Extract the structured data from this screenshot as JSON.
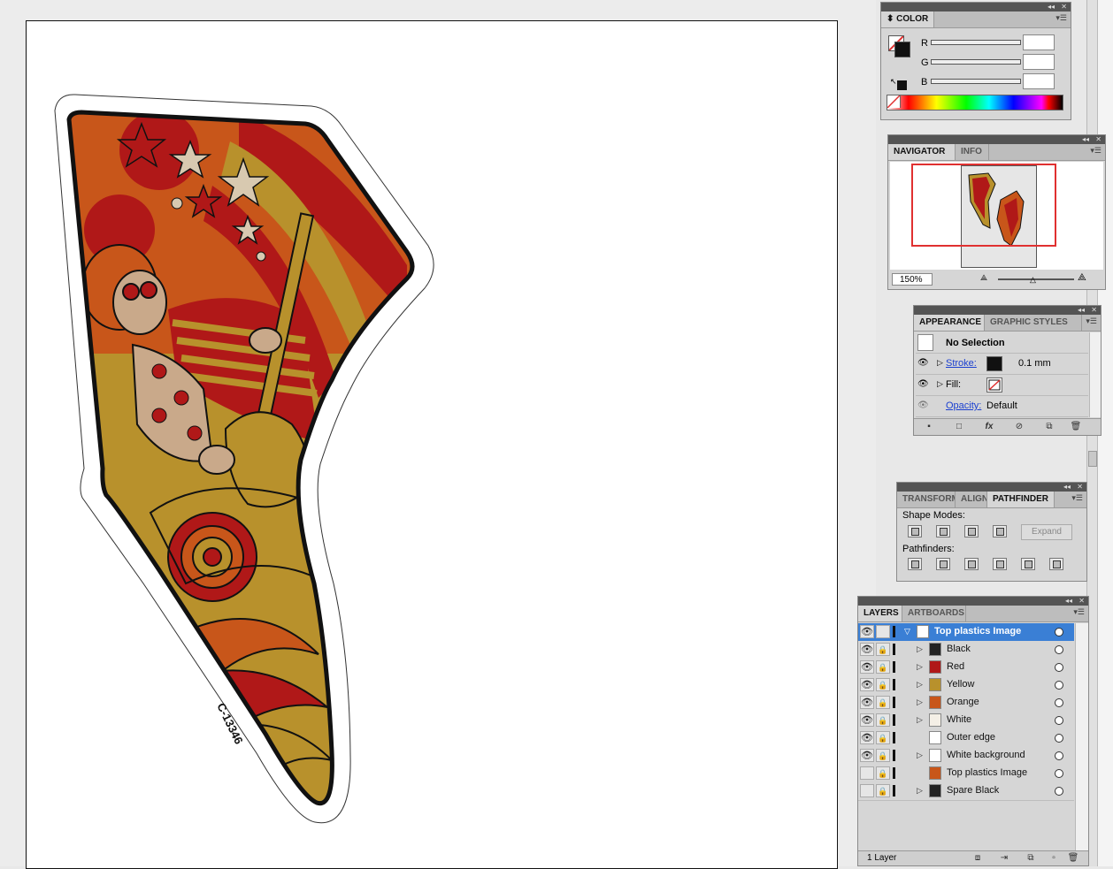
{
  "color_panel": {
    "tab": "COLOR",
    "channels": [
      {
        "label": "R",
        "value": ""
      },
      {
        "label": "G",
        "value": ""
      },
      {
        "label": "B",
        "value": ""
      }
    ]
  },
  "navigator_panel": {
    "tabs": [
      "NAVIGATOR",
      "INFO"
    ],
    "zoom": "150%"
  },
  "appearance_panel": {
    "tabs": [
      "APPEARANCE",
      "GRAPHIC STYLES"
    ],
    "selection": "No Selection",
    "stroke_label": "Stroke:",
    "stroke_value": "0.1 mm",
    "fill_label": "Fill:",
    "opacity_label": "Opacity:",
    "opacity_value": "Default",
    "footer_icons": [
      "new-art-icon",
      "clear-icon",
      "fx-icon",
      "reduce-icon",
      "duplicate-icon",
      "trash-icon"
    ]
  },
  "pathfinder_panel": {
    "tabs": [
      "TRANSFORM",
      "ALIGN",
      "PATHFINDER"
    ],
    "shape_modes_label": "Shape Modes:",
    "pathfinders_label": "Pathfinders:",
    "expand_label": "Expand"
  },
  "layers_panel": {
    "tabs": [
      "LAYERS",
      "ARTBOARDS"
    ],
    "rows": [
      {
        "name": "Top plastics Image",
        "selected": true,
        "indent": 0
      },
      {
        "name": "Black",
        "selected": false,
        "indent": 1
      },
      {
        "name": "Red",
        "selected": false,
        "indent": 1
      },
      {
        "name": "Yellow",
        "selected": false,
        "indent": 1
      },
      {
        "name": "Orange",
        "selected": false,
        "indent": 1
      },
      {
        "name": "White",
        "selected": false,
        "indent": 1
      },
      {
        "name": "Outer edge",
        "selected": false,
        "indent": 1
      },
      {
        "name": "White background",
        "selected": false,
        "indent": 1
      },
      {
        "name": "Top plastics Image",
        "selected": false,
        "indent": 1
      },
      {
        "name": "Spare Black",
        "selected": false,
        "indent": 1
      }
    ],
    "footer_count": "1 Layer"
  },
  "artwork": {
    "part_number": "C-13346"
  },
  "colors": {
    "selection": "#3a7fd5",
    "accent_red": "#e03030",
    "art_orange": "#c8561a",
    "art_red": "#b01818",
    "art_mustard": "#b8912c",
    "art_tan": "#c9a98a"
  }
}
